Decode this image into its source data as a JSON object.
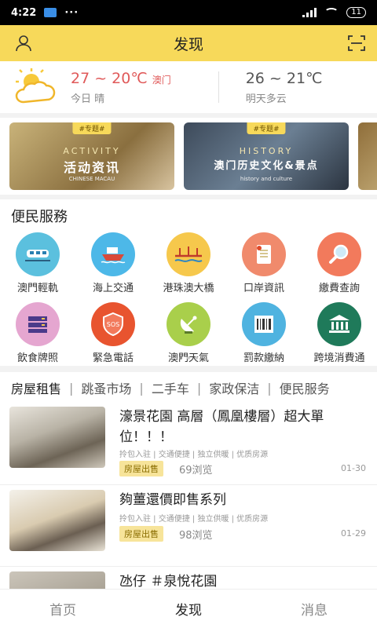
{
  "status": {
    "time": "4:22",
    "battery": "11",
    "dots": "···"
  },
  "header": {
    "title": "发现",
    "user_icon": "user-icon",
    "scan_icon": "scan-icon"
  },
  "weather": {
    "today_temp": "27 ~ 20℃",
    "city": "澳门",
    "today_desc": "今日 晴",
    "tomorrow_temp": "26 ~ 21℃",
    "tomorrow_desc": "明天多云",
    "icon": "sun-cloud-icon"
  },
  "banners": [
    {
      "tag": "#专题#",
      "en": "ACTIVITY",
      "cn": "活动资讯",
      "small": "CHINESE MACAU"
    },
    {
      "tag": "#专题#",
      "en": "HISTORY",
      "cn": "澳门历史文化&景点",
      "small": "history and culture"
    }
  ],
  "services": {
    "title": "便民服務",
    "items": [
      {
        "label": "澳門輕軌",
        "icon": "light-rail-icon",
        "color": "#5bc0de"
      },
      {
        "label": "海上交通",
        "icon": "ferry-icon",
        "color": "#4db8e8"
      },
      {
        "label": "港珠澳大橋",
        "icon": "bridge-icon",
        "color": "#f6c84c"
      },
      {
        "label": "口岸資訊",
        "icon": "document-icon",
        "color": "#f08a6c"
      },
      {
        "label": "繳費查詢",
        "icon": "magnifier-icon",
        "color": "#f27a5c"
      },
      {
        "label": "飲食牌照",
        "icon": "license-icon",
        "color": "#e5a6d0"
      },
      {
        "label": "緊急電話",
        "icon": "sos-shield-icon",
        "color": "#e8542f"
      },
      {
        "label": "澳門天氣",
        "icon": "satellite-dish-icon",
        "color": "#a9cf4b"
      },
      {
        "label": "罰款繳納",
        "icon": "barcode-icon",
        "color": "#4fb3e0"
      },
      {
        "label": "跨境消費通",
        "icon": "bank-icon",
        "color": "#1f7a5a"
      }
    ]
  },
  "categories": [
    "房屋租售",
    "跳蚤市场",
    "二手车",
    "家政保洁",
    "便民服务"
  ],
  "listings": [
    {
      "title": "濠景花園 高層（鳳凰樓層）超大單位！！！",
      "features": "拎包入驻 | 交通便捷 | 独立供暖 | 优质房源",
      "badge": "房屋出售",
      "views": "69浏览",
      "date": "01-30"
    },
    {
      "title": "夠薑還價即售系列",
      "features": "拎包入驻 | 交通便捷 | 独立供暖 | 优质房源",
      "badge": "房屋出售",
      "views": "98浏览",
      "date": "01-29"
    },
    {
      "title": "氹仔 ＃泉悅花園",
      "features": "",
      "badge": "",
      "views": "",
      "date": ""
    }
  ],
  "tabs": [
    "首页",
    "发现",
    "消息"
  ]
}
